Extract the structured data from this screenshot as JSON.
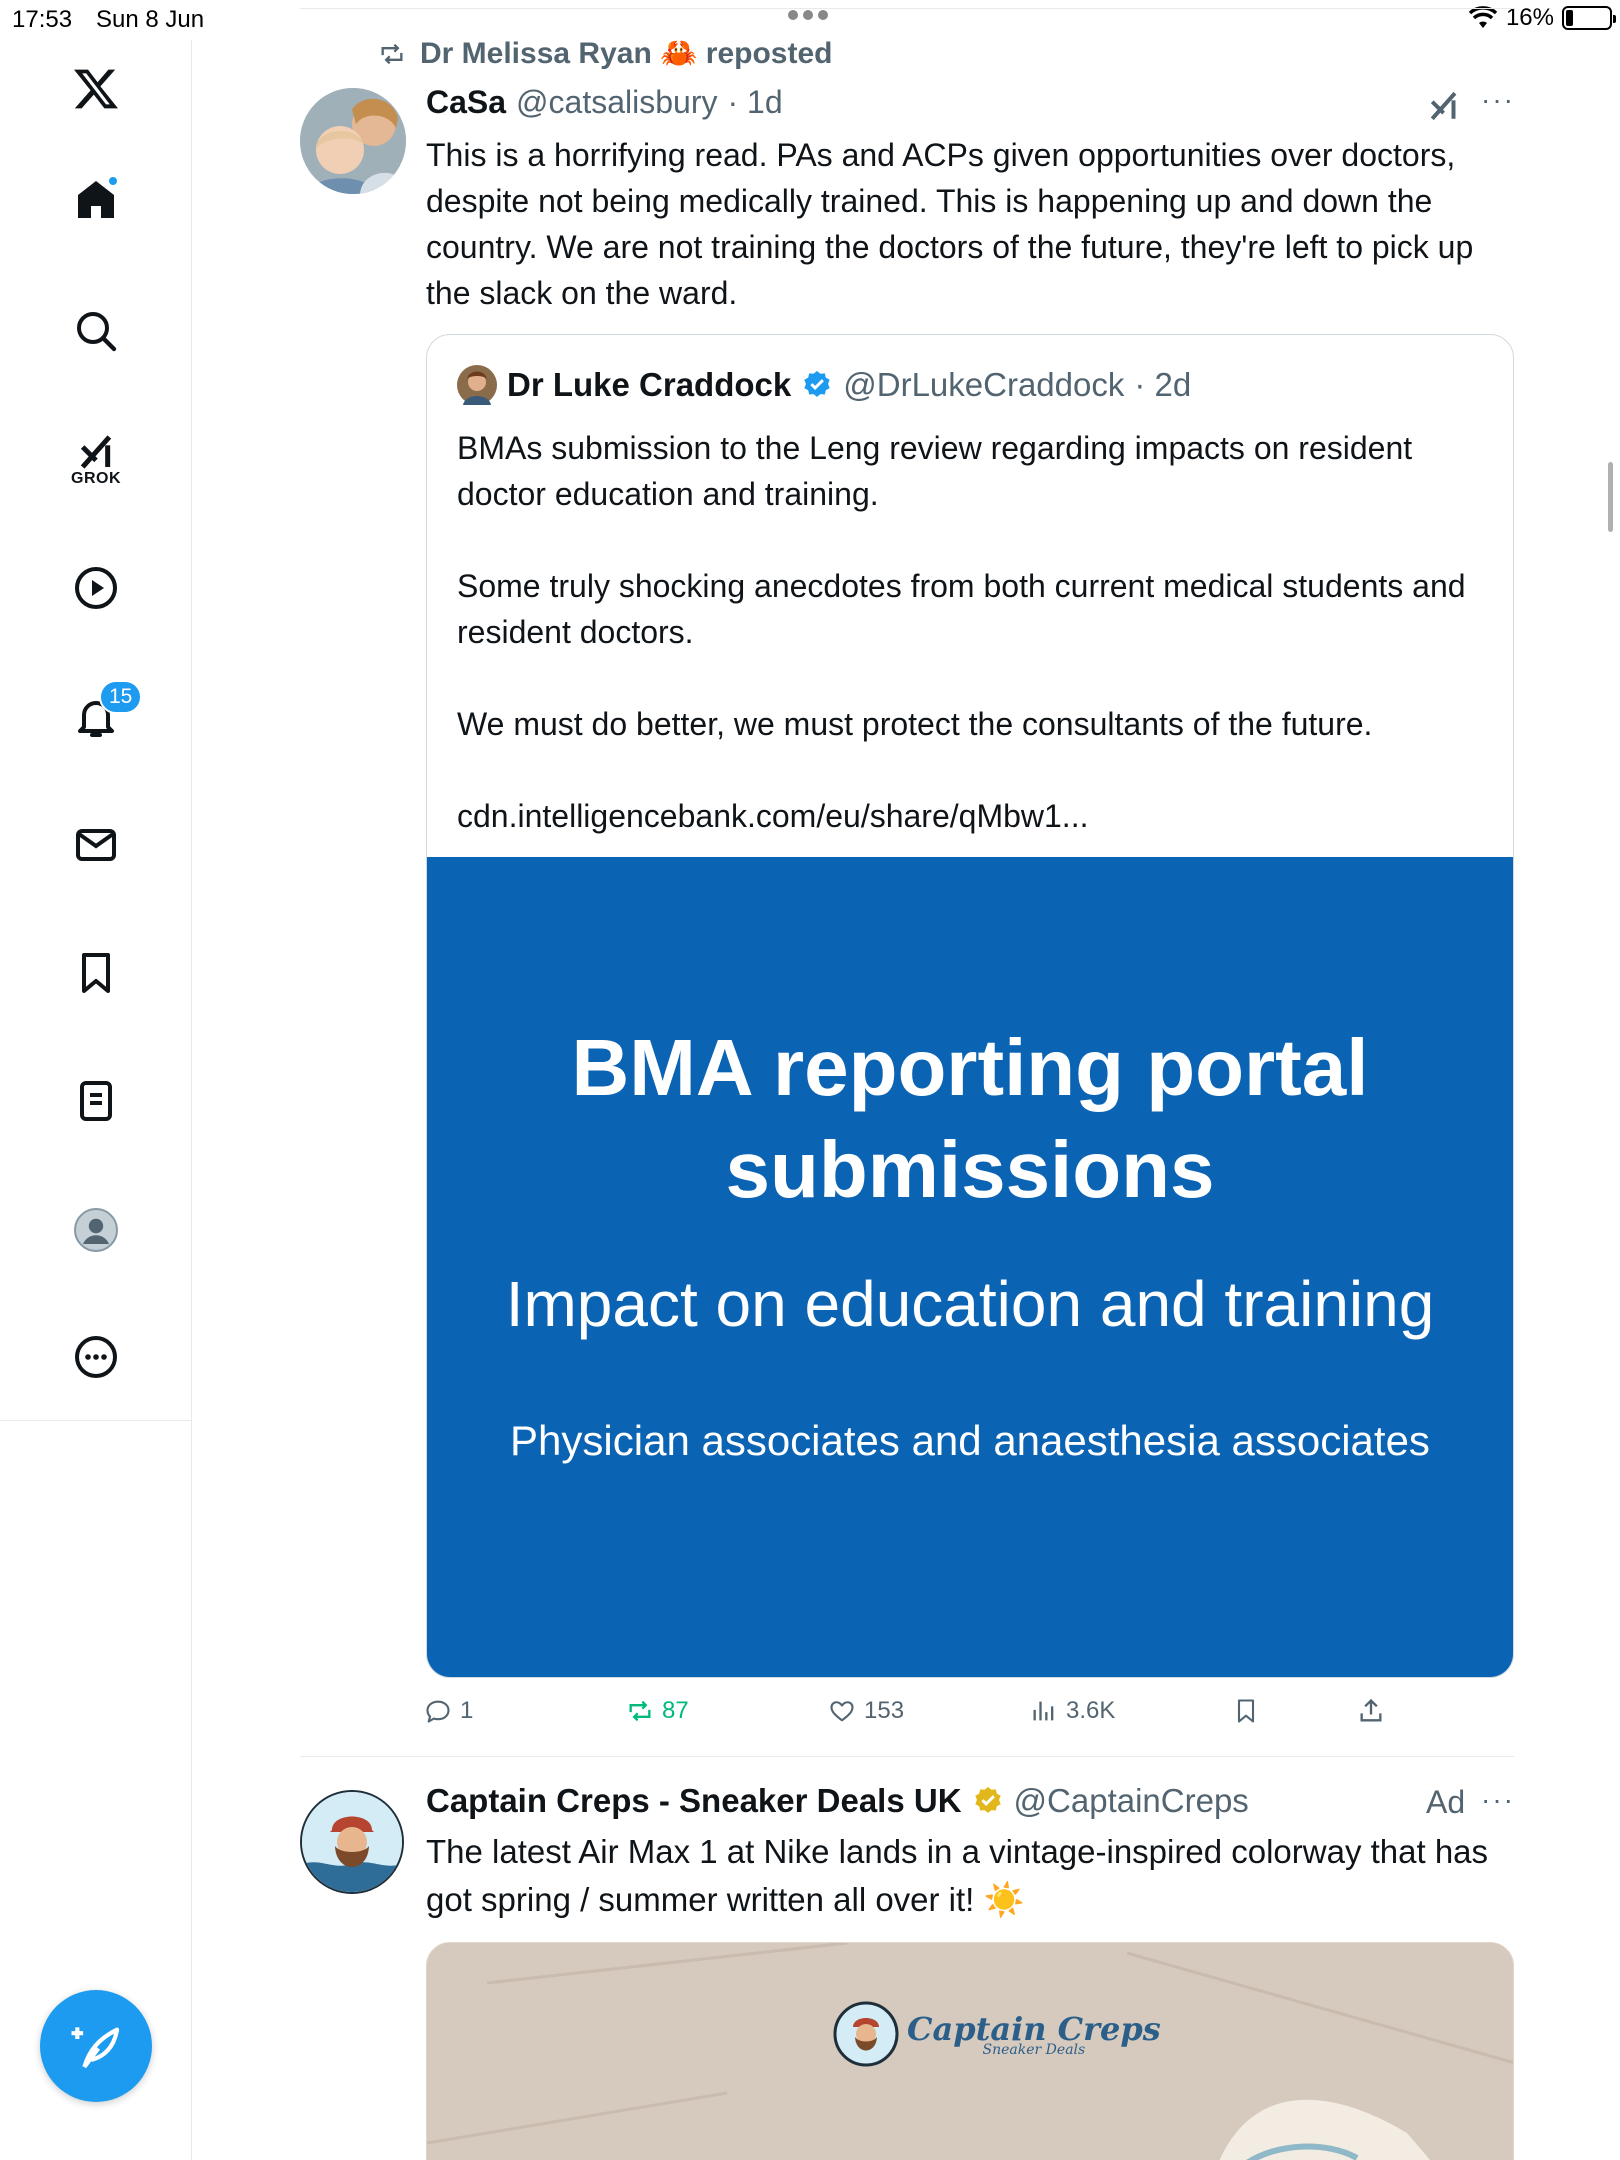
{
  "status_bar": {
    "time": "17:53",
    "date": "Sun 8 Jun",
    "battery": "16%"
  },
  "sidebar": {
    "grok_label": "GROK",
    "notifications_badge": "15",
    "items": [
      "x-logo",
      "home",
      "search",
      "grok",
      "video",
      "notifications",
      "messages",
      "bookmarks",
      "lists",
      "profile",
      "more"
    ]
  },
  "tweet": {
    "repost_label": "Dr Melissa Ryan 🦀 reposted",
    "name": "CaSa",
    "handle": "@catsalisbury",
    "time": "· 1d",
    "text": "This is a horrifying read. PAs and ACPs given opportunities over doctors, despite not being medically trained. This is happening up and down the country. We are not training the doctors of the future, they're left to pick up the slack on the ward.",
    "quote": {
      "name": "Dr Luke Craddock",
      "handle": "@DrLukeCraddock",
      "time": "· 2d",
      "paragraphs": [
        "BMAs submission to the Leng review regarding impacts on resident doctor education and training.",
        "Some truly shocking anecdotes from both current medical students and resident doctors.",
        "We must do better, we must protect the consultants of the future.",
        "cdn.intelligencebank.com/eu/share/qMbw1..."
      ],
      "banner": {
        "title_line1": "BMA reporting portal",
        "title_line2": "submissions",
        "subtitle": "Impact on education and training",
        "subtitle2": "Physician associates and anaesthesia associates"
      }
    },
    "actions": {
      "replies": "1",
      "reposts": "87",
      "likes": "153",
      "views": "3.6K"
    }
  },
  "ad_tweet": {
    "name": "Captain Creps - Sneaker Deals UK",
    "handle": "@CaptainCreps",
    "ad_label": "Ad",
    "text": "The latest Air Max 1 at Nike lands in a vintage-inspired colorway that has got spring / summer written all over it! ☀️",
    "logo_text": "Captain Creps",
    "logo_sub": "Sneaker Deals"
  }
}
